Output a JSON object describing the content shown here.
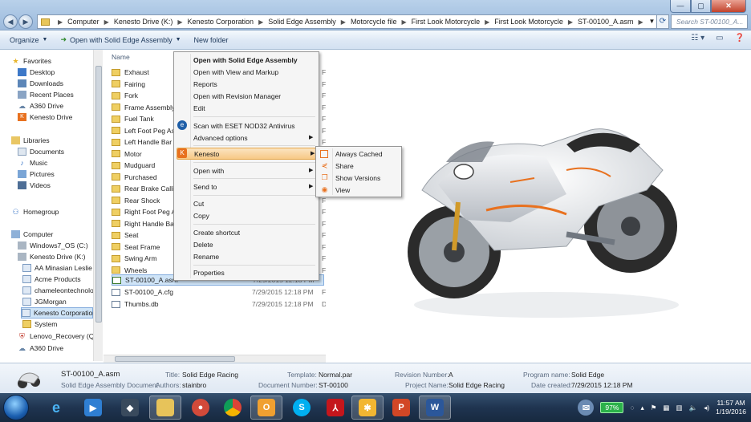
{
  "address": {
    "crumbs": [
      "Computer",
      "Kenesto Drive (K:)",
      "Kenesto Corporation",
      "Solid Edge Assembly",
      "Motorcycle file",
      "First Look Motorcycle",
      "First Look Motorcycle",
      "ST-00100_A.asm"
    ],
    "search_placeholder": "Search ST-00100_A..."
  },
  "toolbar": {
    "organize": "Organize",
    "open_with": "Open with Solid Edge Assembly",
    "new_folder": "New folder"
  },
  "nav": {
    "favorites_header": "Favorites",
    "favorites": [
      "Desktop",
      "Downloads",
      "Recent Places",
      "A360 Drive",
      "Kenesto Drive"
    ],
    "libraries_header": "Libraries",
    "libraries": [
      "Documents",
      "Music",
      "Pictures",
      "Videos"
    ],
    "homegroup": "Homegroup",
    "computer_header": "Computer",
    "computer": [
      "Windows7_OS (C:)",
      "Kenesto Drive (K:)"
    ],
    "kenesto_children": [
      "AA Minasian Leslie",
      "Acme Products",
      "chameleontechnolo",
      "JGMorgan",
      "Kenesto Corporation",
      "System"
    ],
    "tail": [
      "Lenovo_Recovery (Q:)",
      "A360 Drive"
    ]
  },
  "files": {
    "column_name": "Name",
    "folders": [
      "Exhaust",
      "Fairing",
      "Fork",
      "Frame Assembly",
      "Fuel Tank",
      "Left Foot Peg Ass",
      "Left Handle Bar A",
      "Motor",
      "Mudguard",
      "Purchased",
      "Rear Brake Callipe",
      "Rear Shock",
      "Right Foot Peg As",
      "Right Handle Bar",
      "Seat",
      "Seat Frame",
      "Swing Arm",
      "Wheels"
    ],
    "type_letter": "F",
    "docs": [
      {
        "name": "ST-00100_A.asm",
        "date": "7/29/2015 12:18 PM",
        "type": ""
      },
      {
        "name": "ST-00100_A.cfg",
        "date": "7/29/2015 12:18 PM",
        "type": "F"
      },
      {
        "name": "Thumbs.db",
        "date": "7/29/2015 12:18 PM",
        "type": "D"
      }
    ]
  },
  "context_menu": {
    "items": {
      "open_default": "Open with Solid Edge Assembly",
      "open_view": "Open with View and Markup",
      "reports": "Reports",
      "open_revision": "Open with Revision Manager",
      "edit": "Edit",
      "scan": "Scan with ESET NOD32 Antivirus",
      "advanced": "Advanced options",
      "kenesto": "Kenesto",
      "open_with": "Open with",
      "send_to": "Send to",
      "cut": "Cut",
      "copy": "Copy",
      "create_shortcut": "Create shortcut",
      "delete": "Delete",
      "rename": "Rename",
      "properties": "Properties"
    }
  },
  "submenu": {
    "items": [
      "Always Cached",
      "Share",
      "Show Versions",
      "View"
    ]
  },
  "details": {
    "filename": "ST-00100_A.asm",
    "filetype": "Solid Edge Assembly Document",
    "title_label": "Title:",
    "title": "Solid Edge Racing",
    "authors_label": "Authors:",
    "authors": "stainbro",
    "template_label": "Template:",
    "template": "Normal.par",
    "docnum_label": "Document Number:",
    "docnum": "ST-00100",
    "revision_label": "Revision Number:",
    "revision": "A",
    "project_label": "Project Name:",
    "project": "Solid Edge Racing",
    "program_label": "Program name:",
    "program": "Solid Edge",
    "created_label": "Date created:",
    "created": "7/29/2015 12:18 PM"
  },
  "taskbar": {
    "battery": "97%",
    "time": "11:57 AM",
    "date": "1/19/2016"
  },
  "colors": {
    "accent": "#e8711f",
    "selection": "#cfe4f7",
    "menu_highlight": "#f7c986"
  }
}
